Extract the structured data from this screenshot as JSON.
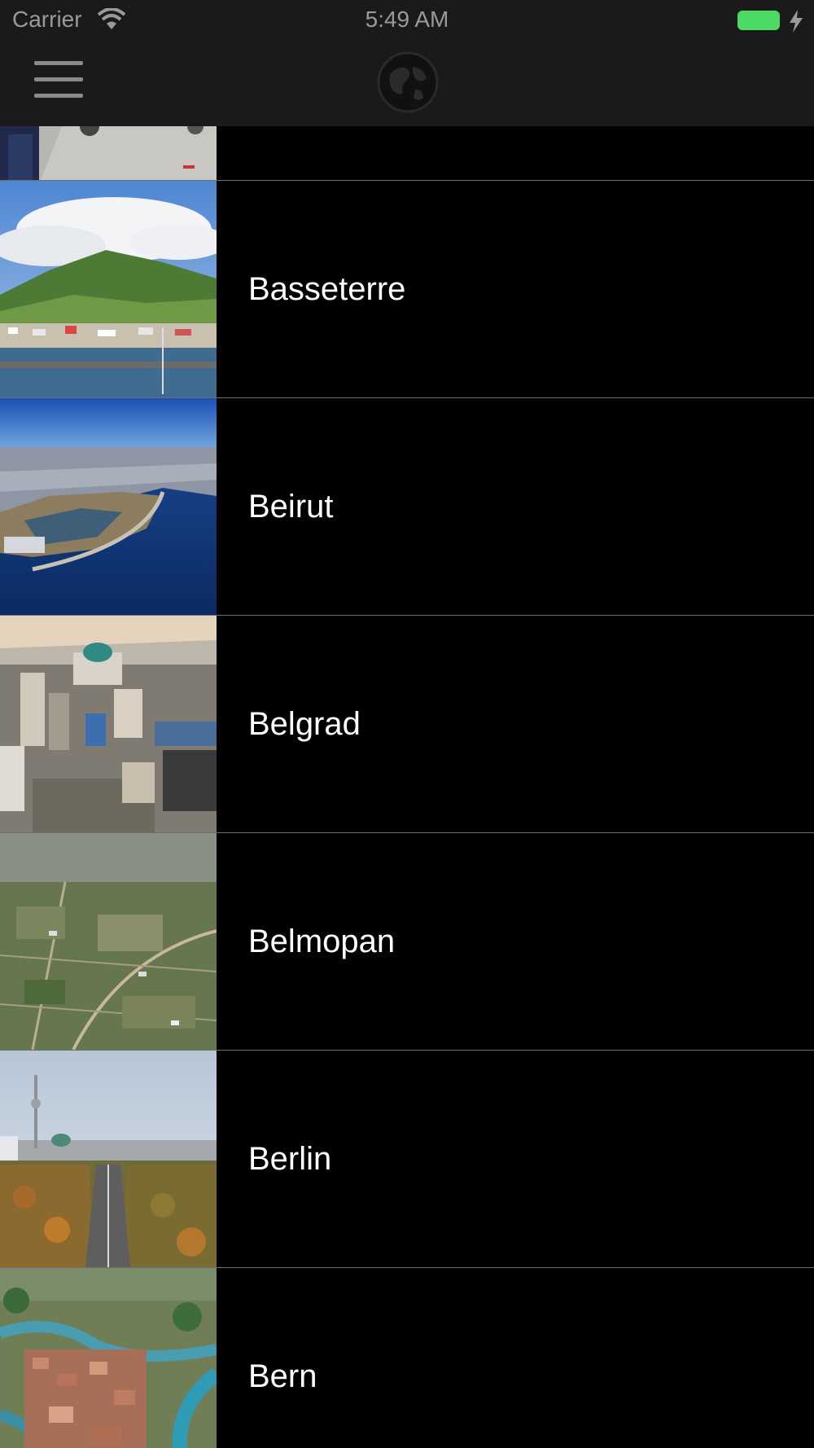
{
  "status_bar": {
    "carrier": "Carrier",
    "time": "5:49 AM",
    "wifi_icon": "wifi-icon",
    "battery_icon": "battery-icon",
    "battery_color": "#4cd964",
    "charging_icon": "charging-bolt-icon"
  },
  "nav_bar": {
    "menu_icon": "hamburger-menu-icon",
    "logo_icon": "globe-icon"
  },
  "cities": [
    {
      "name": "",
      "thumbnail": "street-market-photo"
    },
    {
      "name": "Basseterre",
      "thumbnail": "basseterre-photo"
    },
    {
      "name": "Beirut",
      "thumbnail": "beirut-photo"
    },
    {
      "name": "Belgrad",
      "thumbnail": "belgrad-photo"
    },
    {
      "name": "Belmopan",
      "thumbnail": "belmopan-photo"
    },
    {
      "name": "Berlin",
      "thumbnail": "berlin-photo"
    },
    {
      "name": "Bern",
      "thumbnail": "bern-photo"
    }
  ],
  "colors": {
    "background": "#000000",
    "navbar": "#1a1a1a",
    "text": "#ffffff",
    "separator": "#6e6e6e"
  }
}
